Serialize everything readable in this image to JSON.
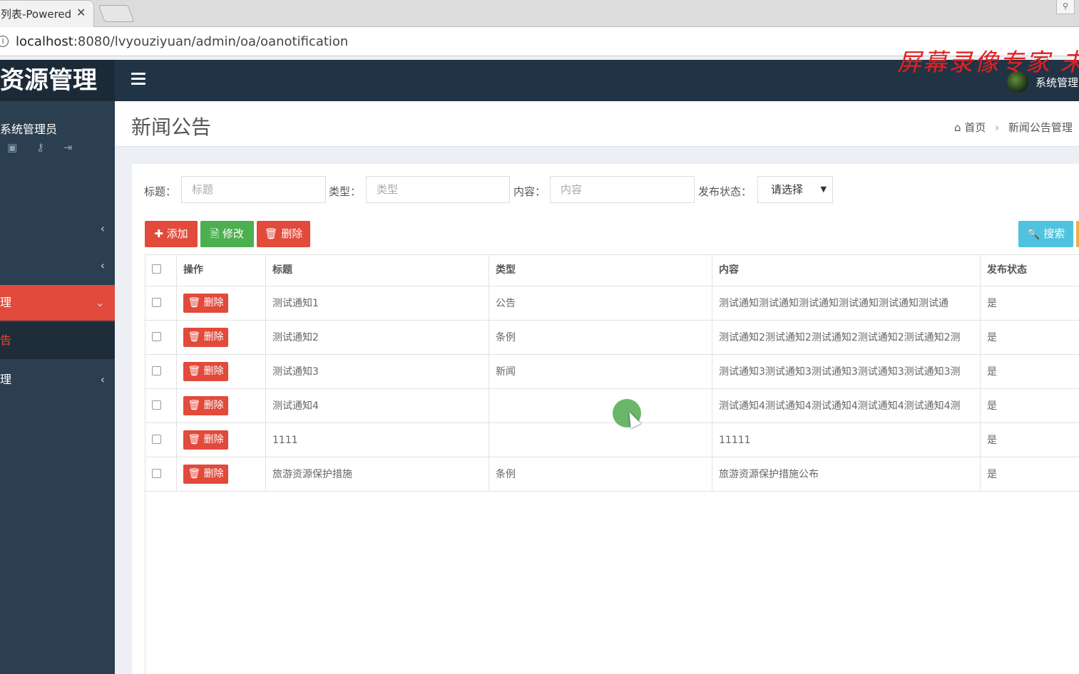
{
  "browser": {
    "tab_title": "列表-Powered",
    "tab_close": "✕",
    "url_host": "localhost",
    "url_rest": ":8080/lvyouziyuan/admin/oa/oanotification",
    "info_icon": "i",
    "profile_icon": "person-icon"
  },
  "watermark": "屏幕录像专家  未",
  "topbar": {
    "logo": "资源管理",
    "user_name": "系统管理"
  },
  "sidebar": {
    "user": "系统管理员",
    "icons": [
      "camera-icon",
      "key-icon",
      "logout-icon"
    ],
    "items": [
      {
        "label": "",
        "chevron": "‹"
      },
      {
        "label": "",
        "chevron": "‹"
      },
      {
        "label": "理",
        "chevron": "⌄"
      },
      {
        "label": "告",
        "chevron": ""
      },
      {
        "label": "理",
        "chevron": "‹"
      }
    ]
  },
  "header": {
    "title": "新闻公告",
    "breadcrumb_home": "首页",
    "breadcrumb_sep": "›",
    "breadcrumb_current": "新闻公告管理"
  },
  "filters": {
    "title_label": "标题：",
    "title_placeholder": "标题",
    "type_label": "类型：",
    "type_placeholder": "类型",
    "content_label": "内容：",
    "content_placeholder": "内容",
    "status_label": "发布状态：",
    "status_value": "请选择",
    "status_caret": "▼"
  },
  "toolbar": {
    "add": "✚ 添加",
    "edit": "🗎 修改",
    "delete": "🗑 删除",
    "search": "🔍 搜索"
  },
  "table": {
    "headers": [
      "操作",
      "标题",
      "类型",
      "内容",
      "发布状态"
    ],
    "row_delete": "🗑 删除",
    "rows": [
      {
        "title": "测试通知1",
        "type": "公告",
        "content": "测试通知测试通知测试通知测试通知测试通知测试通",
        "status": "是"
      },
      {
        "title": "测试通知2",
        "type": "条例",
        "content": "测试通知2测试通知2测试通知2测试通知2测试通知2测",
        "status": "是"
      },
      {
        "title": "测试通知3",
        "type": "新闻",
        "content": "测试通知3测试通知3测试通知3测试通知3测试通知3测",
        "status": "是"
      },
      {
        "title": "测试通知4",
        "type": "",
        "content": "测试通知4测试通知4测试通知4测试通知4测试通知4测",
        "status": "是"
      },
      {
        "title": "1111",
        "type": "",
        "content": "11111",
        "status": "是"
      },
      {
        "title": "旅游资源保护措施",
        "type": "条例",
        "content": "旅游资源保护措施公布",
        "status": "是"
      }
    ]
  },
  "colors": {
    "topbar": "#213446",
    "sidebar": "#2c3f51",
    "accent_red": "#e24a3b",
    "edit_green": "#4caf50",
    "search_cyan": "#4fc3dd"
  }
}
